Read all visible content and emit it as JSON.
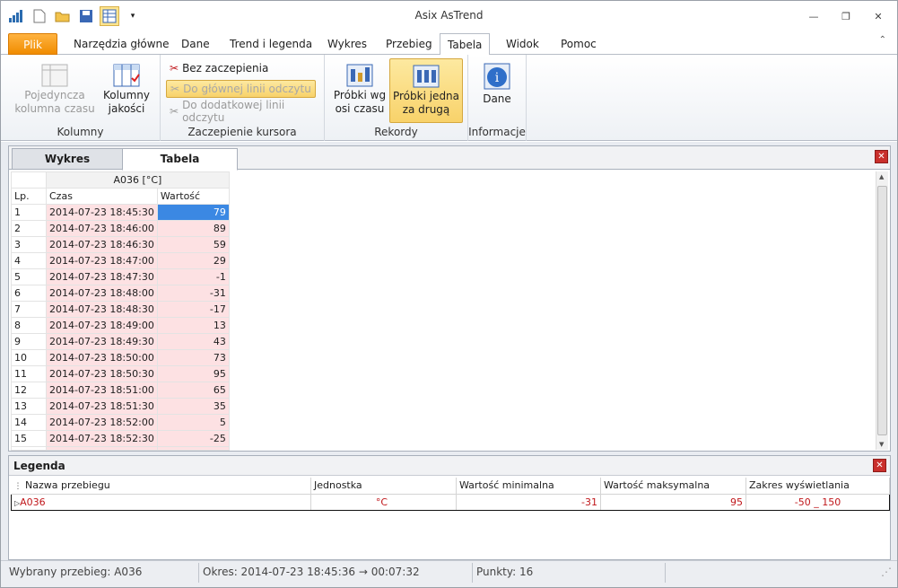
{
  "window": {
    "title": "Asix AsTrend"
  },
  "menu_tabs": [
    "Plik",
    "Narzędzia główne",
    "Dane",
    "Trend i legenda",
    "Wykres",
    "Przebieg",
    "Tabela",
    "Widok",
    "Pomoc"
  ],
  "ribbon": {
    "kolumny": {
      "label": "Kolumny",
      "btn1": "Pojedyncza\nkolumna czasu",
      "btn2": "Kolumny\njakości"
    },
    "zaczepienie": {
      "label": "Zaczepienie kursora",
      "opt1": "Bez zaczepienia",
      "opt2": "Do głównej linii odczytu",
      "opt3": "Do dodatkowej linii odczytu"
    },
    "rekordy": {
      "label": "Rekordy",
      "btn1": "Próbki wg\nosi czasu",
      "btn2": "Próbki jedna\nza drugą"
    },
    "informacje": {
      "label": "Informacje",
      "btn1": "Dane"
    }
  },
  "panel_tabs": [
    "Wykres",
    "Tabela"
  ],
  "table": {
    "series_header": "A036 [°C]",
    "col_lp": "Lp.",
    "col_czas": "Czas",
    "col_wartosc": "Wartość",
    "rows": [
      [
        "1",
        "2014-07-23 18:45:30",
        "79"
      ],
      [
        "2",
        "2014-07-23 18:46:00",
        "89"
      ],
      [
        "3",
        "2014-07-23 18:46:30",
        "59"
      ],
      [
        "4",
        "2014-07-23 18:47:00",
        "29"
      ],
      [
        "5",
        "2014-07-23 18:47:30",
        "-1"
      ],
      [
        "6",
        "2014-07-23 18:48:00",
        "-31"
      ],
      [
        "7",
        "2014-07-23 18:48:30",
        "-17"
      ],
      [
        "8",
        "2014-07-23 18:49:00",
        "13"
      ],
      [
        "9",
        "2014-07-23 18:49:30",
        "43"
      ],
      [
        "10",
        "2014-07-23 18:50:00",
        "73"
      ],
      [
        "11",
        "2014-07-23 18:50:30",
        "95"
      ],
      [
        "12",
        "2014-07-23 18:51:00",
        "65"
      ],
      [
        "13",
        "2014-07-23 18:51:30",
        "35"
      ],
      [
        "14",
        "2014-07-23 18:52:00",
        "5"
      ],
      [
        "15",
        "2014-07-23 18:52:30",
        "-25"
      ]
    ]
  },
  "legend": {
    "title": "Legenda",
    "headers": [
      "Nazwa przebiegu",
      "Jednostka",
      "Wartość minimalna",
      "Wartość maksymalna",
      "Zakres wyświetlania"
    ],
    "row": [
      "A036",
      "°C",
      "-31",
      "95",
      "-50 _ 150"
    ]
  },
  "status": {
    "selected": "Wybrany przebieg: A036",
    "period": "Okres: 2014-07-23  18:45:36 → 00:07:32",
    "points": "Punkty: 16"
  },
  "colors": {
    "accent_orange": "#f08c00",
    "cell_pink": "#fde1e3",
    "selection_blue": "#3b88e3",
    "legend_red": "#c0171b"
  }
}
